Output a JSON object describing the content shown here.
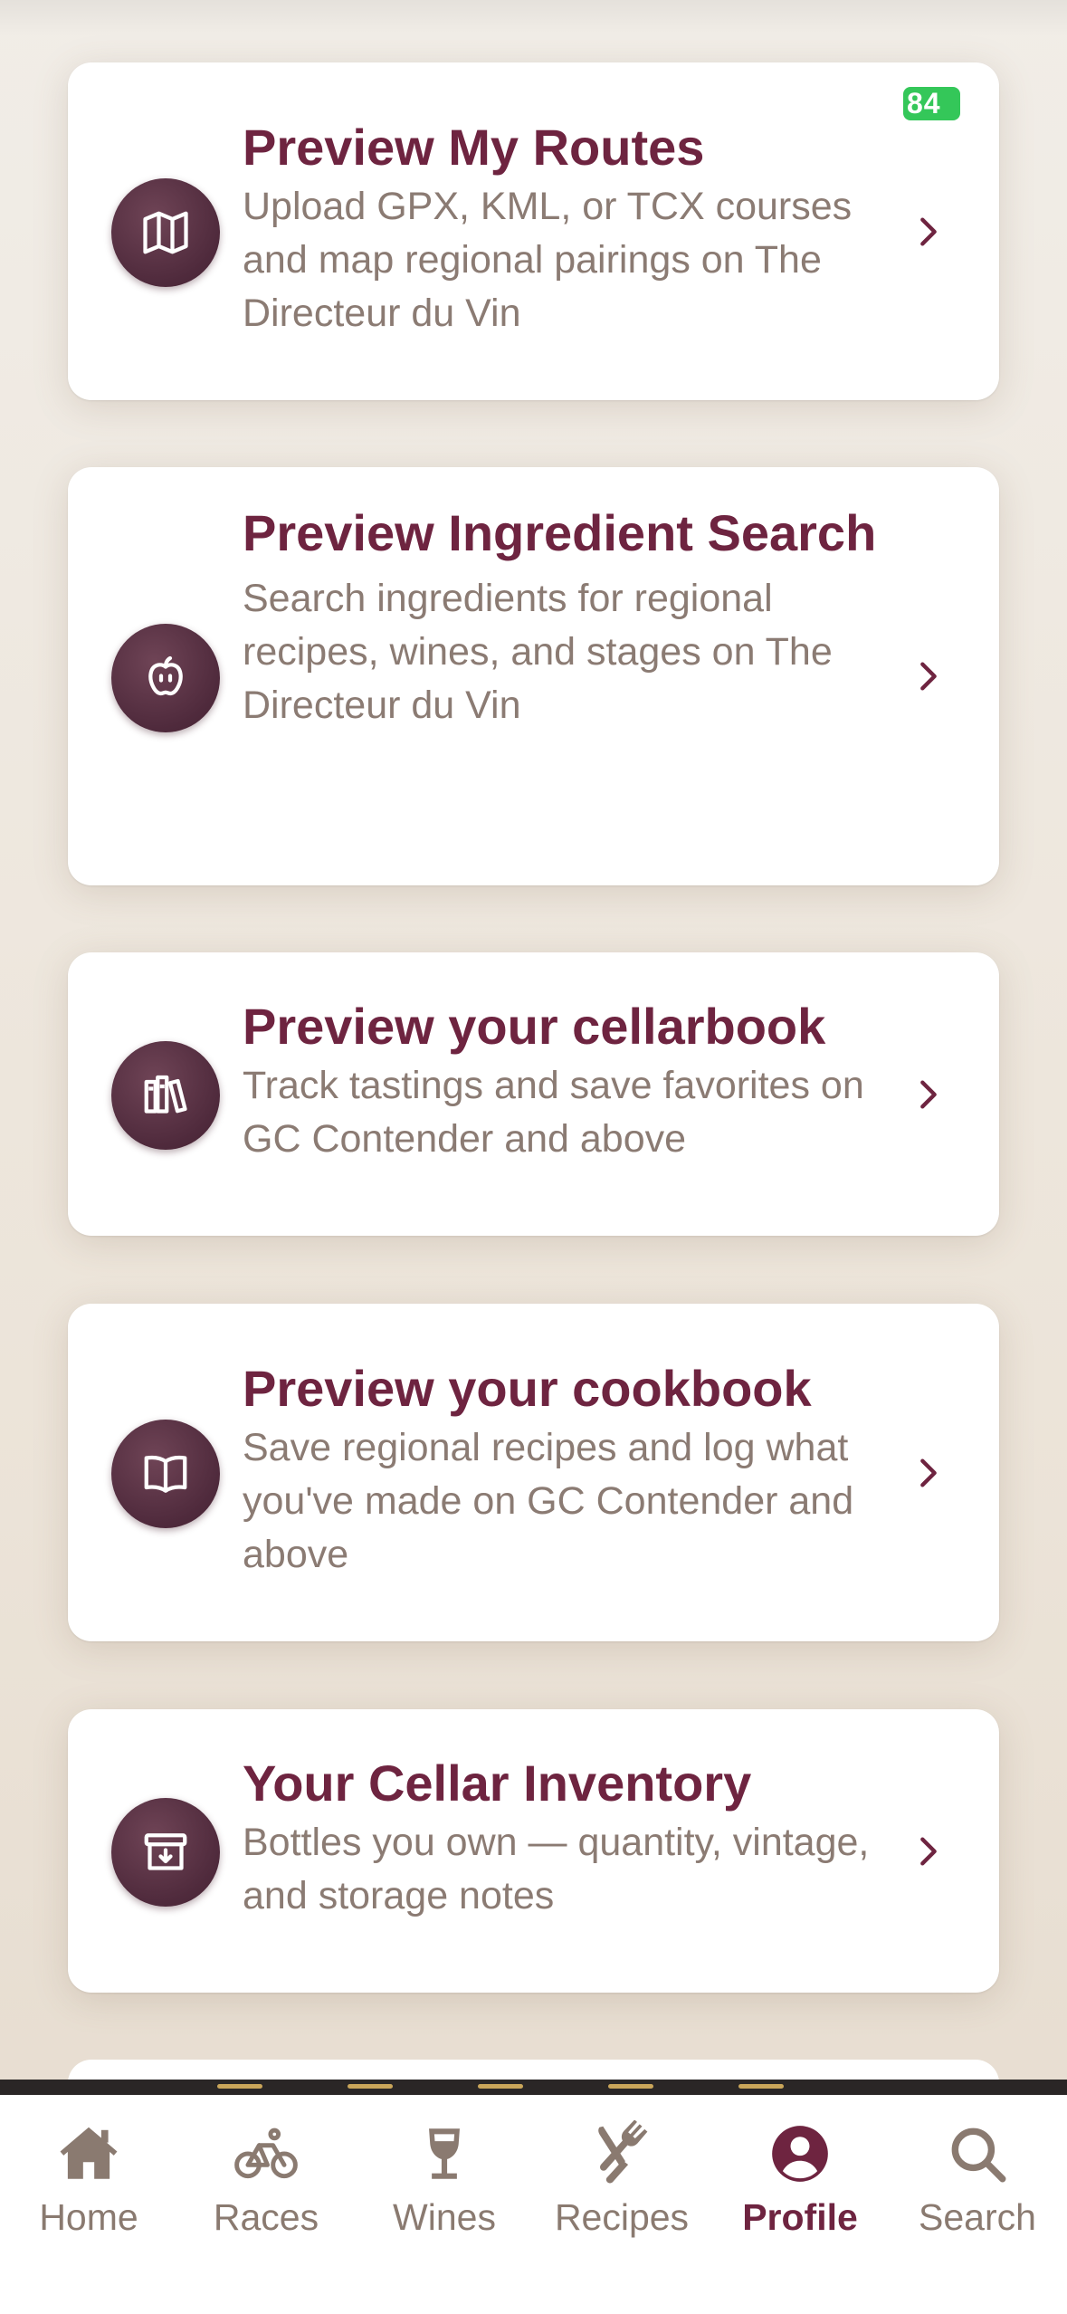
{
  "status": {
    "battery": "84"
  },
  "cards": [
    {
      "title": "Preview My Routes",
      "description": "Upload GPX, KML, or TCX courses and map regional pairings on The Directeur du Vin",
      "icon": "map-icon"
    },
    {
      "title": "Preview Ingredient Search",
      "description": "Search ingredients for regional recipes, wines, and stages on The Directeur du Vin",
      "icon": "apple-icon"
    },
    {
      "title": "Preview your cellarbook",
      "description": "Track tastings and save favorites on GC Contender and above",
      "icon": "books-icon"
    },
    {
      "title": "Preview your cookbook",
      "description": "Save regional recipes and log what you've made on GC Contender and above",
      "icon": "open-book-icon"
    },
    {
      "title": "Your Cellar Inventory",
      "description": "Bottles you own — quantity, vintage, and storage notes",
      "icon": "archive-box-icon"
    }
  ],
  "tabs": [
    {
      "label": "Home",
      "icon": "home-icon",
      "active": false
    },
    {
      "label": "Races",
      "icon": "bicycle-icon",
      "active": false
    },
    {
      "label": "Wines",
      "icon": "wine-glass-icon",
      "active": false
    },
    {
      "label": "Recipes",
      "icon": "fork-knife-icon",
      "active": false
    },
    {
      "label": "Profile",
      "icon": "profile-icon",
      "active": true
    },
    {
      "label": "Search",
      "icon": "search-icon",
      "active": false
    }
  ],
  "colors": {
    "accent": "#6e2440",
    "icon_circle": "#4f2a3c",
    "secondary_text": "#8b7b73",
    "battery": "#34c759",
    "tab_indicator": "#c9a55a"
  }
}
